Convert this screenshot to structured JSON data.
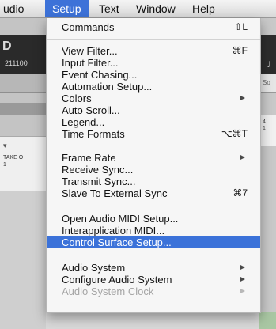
{
  "menubar": {
    "items": [
      {
        "label": "udio"
      },
      {
        "label": "Setup"
      },
      {
        "label": "Text"
      },
      {
        "label": "Window"
      },
      {
        "label": "Help"
      }
    ]
  },
  "background": {
    "left_big": "D",
    "left_counter": "211100",
    "left_drop": "▾",
    "take_label": "TAKE O",
    "take_number": "1",
    "right_short": "So",
    "right_ruler": "4\n1"
  },
  "setup_menu": {
    "groups": [
      [
        {
          "label": "Commands",
          "shortcut": "⇧L"
        }
      ],
      [
        {
          "label": "View Filter...",
          "shortcut": "⌘F"
        },
        {
          "label": "Input Filter..."
        },
        {
          "label": "Event Chasing..."
        },
        {
          "label": "Automation Setup..."
        },
        {
          "label": "Colors",
          "submenu": true
        },
        {
          "label": "Auto Scroll..."
        },
        {
          "label": "Legend..."
        },
        {
          "label": "Time Formats",
          "shortcut": "⌥⌘T"
        }
      ],
      [
        {
          "label": "Frame Rate",
          "submenu": true
        },
        {
          "label": "Receive Sync..."
        },
        {
          "label": "Transmit Sync..."
        },
        {
          "label": "Slave To External Sync",
          "shortcut": "⌘7"
        }
      ],
      [
        {
          "label": "Open Audio MIDI Setup..."
        },
        {
          "label": "Interapplication MIDI..."
        },
        {
          "label": "Control Surface Setup...",
          "highlighted": true
        }
      ],
      [
        {
          "label": "Audio System",
          "submenu": true
        },
        {
          "label": "Configure Audio System",
          "submenu": true
        },
        {
          "label": "Audio System Clock",
          "submenu": true,
          "disabled": true
        }
      ]
    ]
  },
  "colors": {
    "highlight": "#3b72d9",
    "menu_bg": "#f6f6f6",
    "disabled_text": "#a5a5a5"
  }
}
